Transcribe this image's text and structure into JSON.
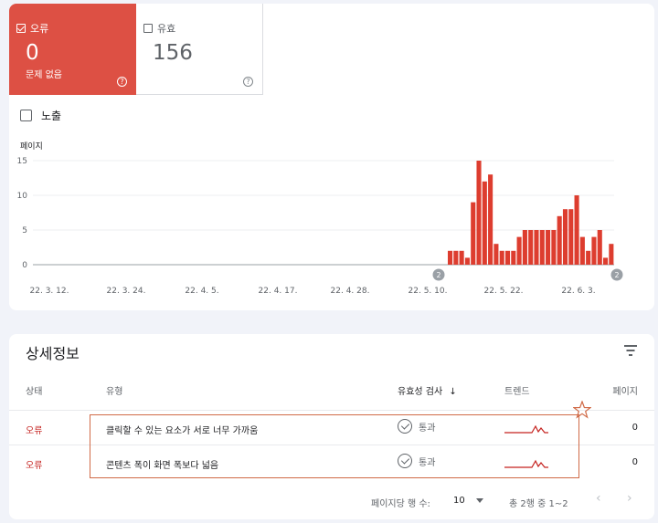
{
  "tiles": {
    "error": {
      "label": "오류",
      "count": "0",
      "sub": "문제 없음",
      "help": "?"
    },
    "valid": {
      "label": "유효",
      "count": "156",
      "help": "?"
    }
  },
  "exposure_label": "노출",
  "chart_data": {
    "type": "bar",
    "ylabel": "페이지",
    "yticks": [
      0,
      5,
      10,
      15
    ],
    "ylim": [
      0,
      15
    ],
    "x_tick_labels": [
      "22. 3. 12.",
      "22. 3. 24.",
      "22. 4. 5.",
      "22. 4. 17.",
      "22. 4. 28.",
      "22. 5. 10.",
      "22. 5. 22.",
      "22. 6. 3."
    ],
    "values": [
      0,
      0,
      0,
      0,
      0,
      0,
      0,
      0,
      0,
      0,
      0,
      0,
      0,
      0,
      0,
      0,
      0,
      0,
      0,
      0,
      0,
      0,
      0,
      0,
      0,
      0,
      0,
      0,
      0,
      0,
      0,
      0,
      0,
      0,
      0,
      0,
      0,
      0,
      0,
      0,
      0,
      0,
      0,
      0,
      0,
      0,
      0,
      0,
      0,
      0,
      0,
      0,
      0,
      0,
      0,
      0,
      0,
      0,
      0,
      0,
      0,
      0,
      0,
      0,
      0,
      0,
      0,
      0,
      0,
      0,
      0,
      0,
      2,
      2,
      2,
      1,
      9,
      15,
      12,
      13,
      3,
      2,
      2,
      2,
      4,
      5,
      5,
      5,
      5,
      5,
      5,
      7,
      8,
      8,
      10,
      4,
      2,
      4,
      5,
      1,
      3
    ],
    "annotations": [
      {
        "label": "2",
        "near": "22. 5. 10."
      },
      {
        "label": "2",
        "near": "end"
      }
    ],
    "color": "#dd3d2f"
  },
  "details": {
    "title": "상세정보",
    "columns": {
      "status": "상태",
      "type": "유형",
      "validation": "유효성 검사",
      "trend": "트렌드",
      "pages": "페이지"
    },
    "rows": [
      {
        "status": "오류",
        "type": "클릭할 수 있는 요소가 서로 너무 가까움",
        "validation": "통과",
        "pages": "0"
      },
      {
        "status": "오류",
        "type": "콘텐츠 폭이 화면 폭보다 넓음",
        "validation": "통과",
        "pages": "0"
      }
    ],
    "pager": {
      "rows_label": "페이지당 행 수:",
      "rows_value": "10",
      "range": "총 2행 중 1~2"
    }
  },
  "colors": {
    "error": "#dd5044",
    "bar": "#dd3d2f",
    "highlight": "#d06a47"
  }
}
